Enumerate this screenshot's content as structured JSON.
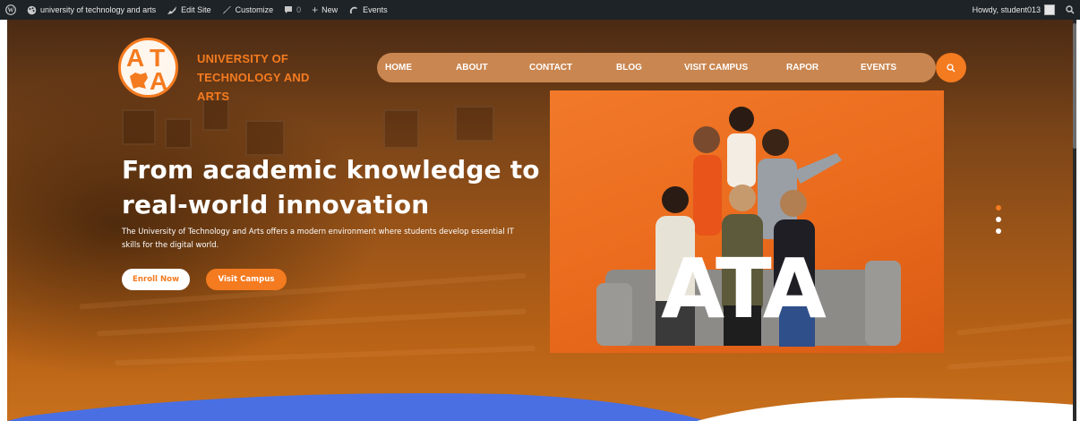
{
  "admin_bar": {
    "site_name": "university of technology and arts",
    "edit_site": "Edit Site",
    "customize": "Customize",
    "comments_count": "0",
    "new_label": "New",
    "events_label": "Events",
    "howdy": "Howdy, student013"
  },
  "header": {
    "logo_letters": [
      "A",
      "T",
      "A"
    ],
    "site_title_line1": "UNIVERSITY OF TECHNOLOGY AND",
    "site_title_line2": "ARTS"
  },
  "nav": {
    "items": [
      {
        "label": "HOME"
      },
      {
        "label": "ABOUT"
      },
      {
        "label": "CONTACT"
      },
      {
        "label": "BLOG"
      },
      {
        "label": "VISIT CAMPUS"
      },
      {
        "label": "RAPOR"
      },
      {
        "label": "EVENTS"
      }
    ]
  },
  "hero": {
    "headline_line1": "From academic knowledge to",
    "headline_line2": "real-world innovation",
    "subtext_line1": "The University of Technology and Arts offers a modern environment where students develop essential IT",
    "subtext_line2": "skills for the digital world.",
    "enroll_label": "Enroll Now",
    "visit_label": "Visit Campus",
    "photo_overlay_text": "ATA"
  },
  "slider": {
    "dots": 3,
    "active_index": 0
  },
  "colors": {
    "accent": "#f47b20",
    "admin_bar": "#1d2327",
    "nav_pill": "#c98650",
    "wave": "#4a6fe3"
  },
  "icons": [
    "wordpress-icon",
    "palette-icon",
    "edit-site-icon",
    "brush-icon",
    "comment-icon",
    "plus-icon",
    "events-icon",
    "search-icon"
  ]
}
